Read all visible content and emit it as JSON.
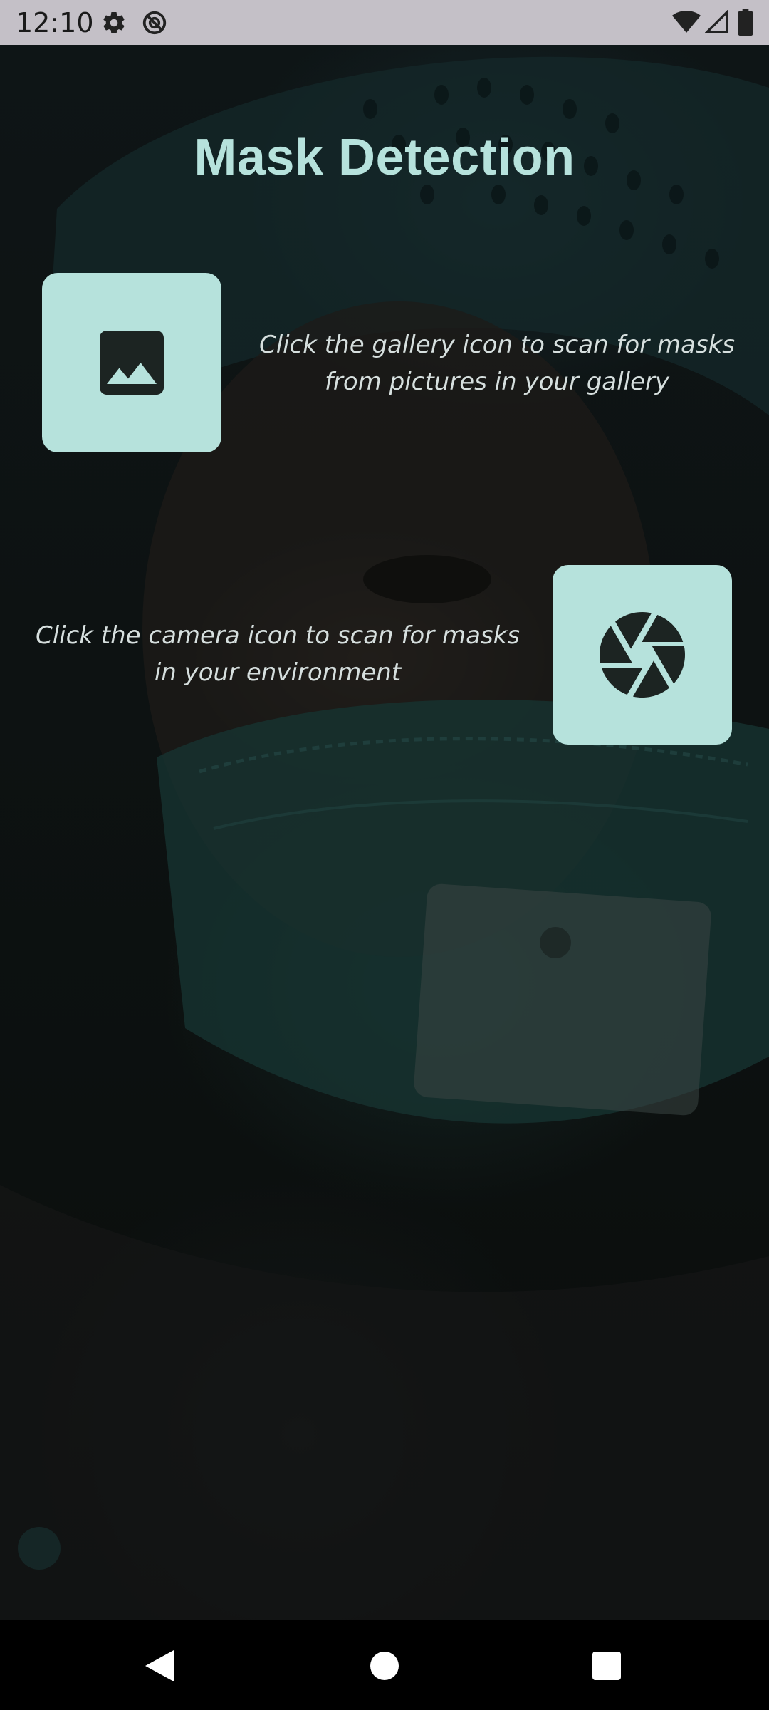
{
  "status_bar": {
    "time": "12:10",
    "icons": [
      "settings-icon",
      "no-sync-icon",
      "wifi-icon",
      "signal-icon",
      "battery-icon"
    ]
  },
  "app": {
    "title": "Mask Detection",
    "gallery": {
      "icon": "image-icon",
      "hint": "Click the gallery icon to scan for masks from pictures in your gallery"
    },
    "camera": {
      "icon": "camera-shutter-icon",
      "hint": "Click the camera icon to scan for masks in your environment"
    }
  },
  "nav_bar": {
    "buttons": [
      "back-icon",
      "home-icon",
      "recents-icon"
    ]
  },
  "colors": {
    "accent": "#b6e2dc",
    "status_bar": "#c4c0c7",
    "icon_dark": "#1c2422"
  }
}
